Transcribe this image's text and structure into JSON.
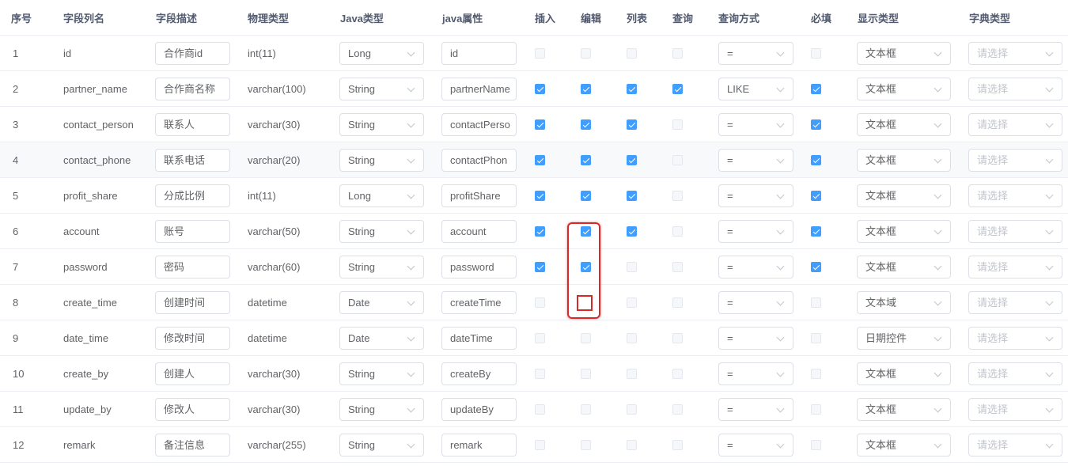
{
  "headers": {
    "index": "序号",
    "column_name": "字段列名",
    "description": "字段描述",
    "physical_type": "物理类型",
    "java_type": "Java类型",
    "java_field": "java属性",
    "insert": "插入",
    "edit": "编辑",
    "list": "列表",
    "query": "查询",
    "query_type": "查询方式",
    "required": "必填",
    "html_type": "显示类型",
    "dict_type": "字典类型"
  },
  "dict_placeholder": "请选择",
  "rows": [
    {
      "index": "1",
      "column_name": "id",
      "description": "合作商id",
      "physical_type": "int(11)",
      "java_type": "Long",
      "java_field": "id",
      "insert": false,
      "edit": false,
      "list": false,
      "query": false,
      "query_type": "=",
      "required": false,
      "html_type": "文本框"
    },
    {
      "index": "2",
      "column_name": "partner_name",
      "description": "合作商名称",
      "physical_type": "varchar(100)",
      "java_type": "String",
      "java_field": "partnerName",
      "insert": true,
      "edit": true,
      "list": true,
      "query": true,
      "query_type": "LIKE",
      "required": true,
      "html_type": "文本框"
    },
    {
      "index": "3",
      "column_name": "contact_person",
      "description": "联系人",
      "physical_type": "varchar(30)",
      "java_type": "String",
      "java_field": "contactPerso",
      "insert": true,
      "edit": true,
      "list": true,
      "query": false,
      "query_type": "=",
      "required": true,
      "html_type": "文本框"
    },
    {
      "index": "4",
      "column_name": "contact_phone",
      "description": "联系电话",
      "physical_type": "varchar(20)",
      "java_type": "String",
      "java_field": "contactPhon",
      "insert": true,
      "edit": true,
      "list": true,
      "query": false,
      "query_type": "=",
      "required": true,
      "html_type": "文本框"
    },
    {
      "index": "5",
      "column_name": "profit_share",
      "description": "分成比例",
      "physical_type": "int(11)",
      "java_type": "Long",
      "java_field": "profitShare",
      "insert": true,
      "edit": true,
      "list": true,
      "query": false,
      "query_type": "=",
      "required": true,
      "html_type": "文本框"
    },
    {
      "index": "6",
      "column_name": "account",
      "description": "账号",
      "physical_type": "varchar(50)",
      "java_type": "String",
      "java_field": "account",
      "insert": true,
      "edit": true,
      "list": true,
      "query": false,
      "query_type": "=",
      "required": true,
      "html_type": "文本框"
    },
    {
      "index": "7",
      "column_name": "password",
      "description": "密码",
      "physical_type": "varchar(60)",
      "java_type": "String",
      "java_field": "password",
      "insert": true,
      "edit": true,
      "list": false,
      "query": false,
      "query_type": "=",
      "required": true,
      "html_type": "文本框"
    },
    {
      "index": "8",
      "column_name": "create_time",
      "description": "创建时间",
      "physical_type": "datetime",
      "java_type": "Date",
      "java_field": "createTime",
      "insert": false,
      "edit": false,
      "list": false,
      "query": false,
      "query_type": "=",
      "required": false,
      "html_type": "文本域"
    },
    {
      "index": "9",
      "column_name": "date_time",
      "description": "修改时间",
      "physical_type": "datetime",
      "java_type": "Date",
      "java_field": "dateTime",
      "insert": false,
      "edit": false,
      "list": false,
      "query": false,
      "query_type": "=",
      "required": false,
      "html_type": "日期控件"
    },
    {
      "index": "10",
      "column_name": "create_by",
      "description": "创建人",
      "physical_type": "varchar(30)",
      "java_type": "String",
      "java_field": "createBy",
      "insert": false,
      "edit": false,
      "list": false,
      "query": false,
      "query_type": "=",
      "required": false,
      "html_type": "文本框"
    },
    {
      "index": "11",
      "column_name": "update_by",
      "description": "修改人",
      "physical_type": "varchar(30)",
      "java_type": "String",
      "java_field": "updateBy",
      "insert": false,
      "edit": false,
      "list": false,
      "query": false,
      "query_type": "=",
      "required": false,
      "html_type": "文本框"
    },
    {
      "index": "12",
      "column_name": "remark",
      "description": "备注信息",
      "physical_type": "varchar(255)",
      "java_type": "String",
      "java_field": "remark",
      "insert": false,
      "edit": false,
      "list": false,
      "query": false,
      "query_type": "=",
      "required": false,
      "html_type": "文本框"
    }
  ],
  "colors": {
    "checked": "#409eff",
    "highlight": "#d42a2a",
    "row_alt": "#f8f9fb"
  }
}
